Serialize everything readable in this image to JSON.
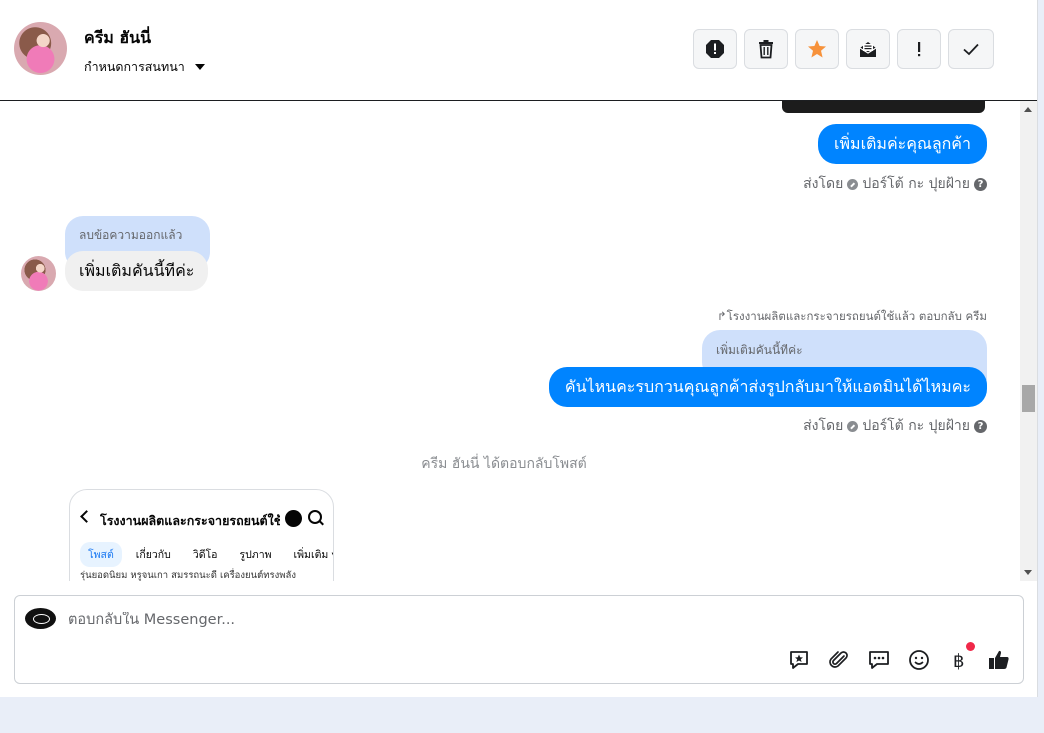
{
  "header": {
    "contact_name": "ครีม ฮันนี่",
    "assign_label": "กำหนดการสนทนา",
    "actions": [
      "spam-report",
      "delete",
      "star",
      "mark-unread",
      "important",
      "done"
    ]
  },
  "thread": {
    "msg1_text": "เพิ่มเติมค่ะคุณลูกค้า",
    "sent_by_label": "ส่งโดย",
    "sent_by_name": "ปอร์โต้ กะ ปุยฝ้าย",
    "deleted_note": "ลบข้อความออกแล้ว",
    "incoming_text": "เพิ่มเติมคันนี้ทีค่ะ",
    "reply_meta": "โรงงานผลิตและกระจายรถยนต์ใช้แล้ว ตอบกลับ ครีม",
    "quoted_text": "เพิ่มเติมคันนี้ทีค่ะ",
    "msg2_text": "คันไหนคะรบกวนคุณลูกค้าส่งรูปกลับมาให้แอดมินได้ไหมคะ",
    "system_note": "ครีม ฮันนี่ ได้ตอบกลับโพสต์",
    "post_card": {
      "title": "โรงงานผลิตและกระจายรถยนต์ใช้แ...",
      "tabs": [
        "โพสต์",
        "เกี่ยวกับ",
        "วิดีโอ",
        "รูปภาพ",
        "เพิ่มเติม ▾"
      ],
      "snippet": "รุ่นยอดนิยม หรูจนเกา สมรรถนะดี เครื่องยนต์ทรงพลัง"
    }
  },
  "composer": {
    "placeholder": "ตอบกลับใน Messenger...",
    "tools": [
      "saved-reply",
      "attach",
      "faq",
      "emoji",
      "payment",
      "like"
    ]
  },
  "colors": {
    "outgoing_bubble": "#0084ff",
    "incoming_bubble": "#f0f0f0",
    "quote_bubble": "#cfe0fb",
    "star": "#f7923b",
    "notification_dot": "#f02849"
  }
}
